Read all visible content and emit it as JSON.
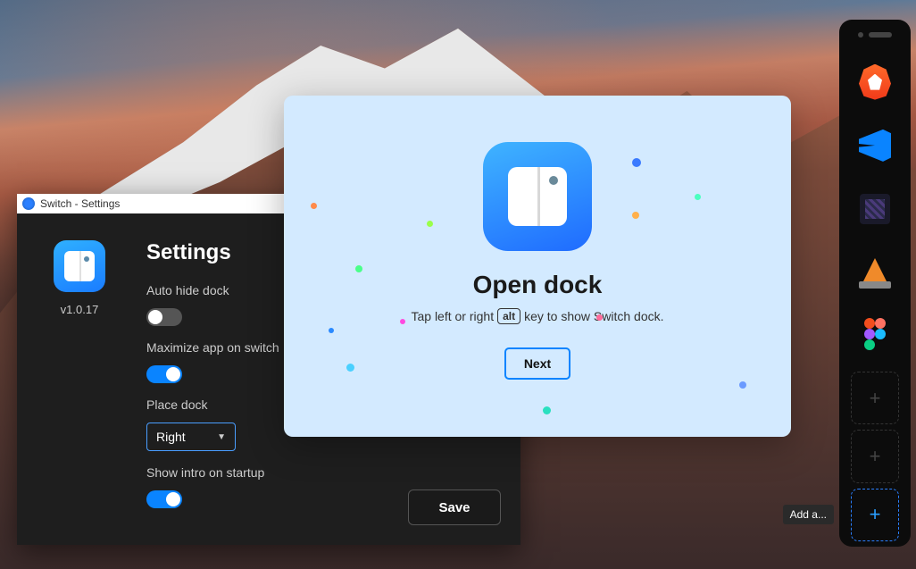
{
  "settings_window": {
    "title": "Switch - Settings",
    "version": "v1.0.17",
    "heading": "Settings",
    "auto_hide": {
      "label": "Auto hide dock",
      "value": false
    },
    "maximize": {
      "label": "Maximize app on switch",
      "value": true
    },
    "place_dock": {
      "label": "Place dock",
      "value": "Right"
    },
    "show_intro": {
      "label": "Show intro on startup",
      "value": true
    },
    "save_label": "Save"
  },
  "intro": {
    "title": "Open dock",
    "sub_pre": "Tap left or right",
    "sub_key": "alt",
    "sub_post": "key to show Switch dock.",
    "next_label": "Next"
  },
  "dock": {
    "items": [
      {
        "name": "brave"
      },
      {
        "name": "vscode"
      },
      {
        "name": "minecraft"
      },
      {
        "name": "vlc"
      },
      {
        "name": "figma"
      }
    ],
    "tooltip": "Add a..."
  }
}
